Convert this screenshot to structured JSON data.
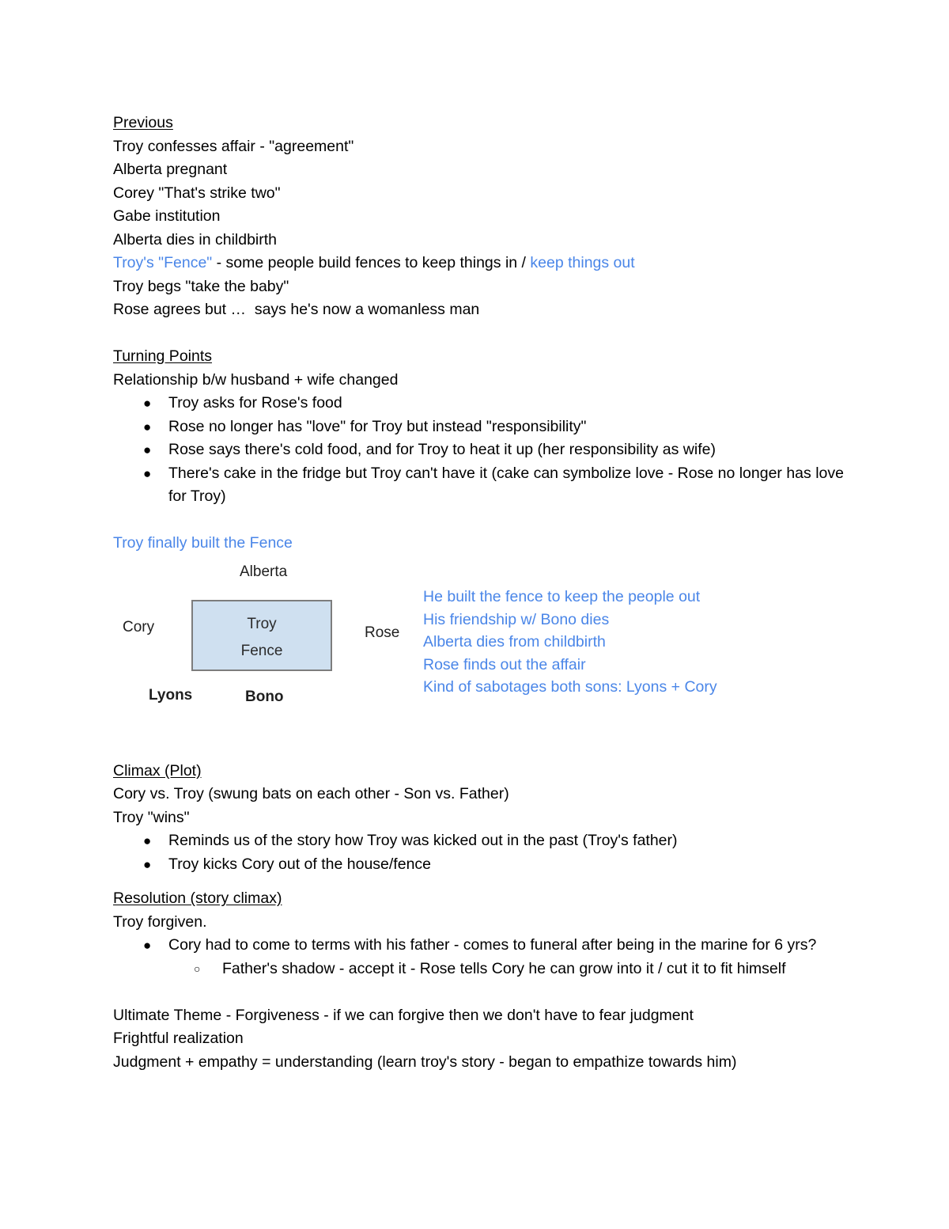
{
  "document": {
    "sections": {
      "previous": {
        "heading": "Previous",
        "lines": [
          "Troy confesses affair - \"agreement\"",
          "Alberta pregnant",
          "Corey \"That's strike two\"",
          "Gabe institution",
          "Alberta dies in childbirth"
        ],
        "fence_line": {
          "blue_start": "Troy's \"Fence\"",
          "black_middle": " - some people build fences to keep things in / ",
          "blue_end": "keep things out"
        },
        "lines_after": [
          "Troy begs \"take the baby\"",
          "Rose agrees but …  says he's now a womanless man"
        ]
      },
      "turning_points": {
        "heading": "Turning Points",
        "intro": "Relationship b/w husband + wife changed",
        "bullets": [
          "Troy asks for Rose's food",
          "Rose no longer has \"love\" for Troy but instead \"responsibility\"",
          "Rose says there's cold food, and for Troy to heat it up (her responsibility as wife)",
          "There's cake in the fridge but Troy can't have it (cake can symbolize love - Rose no longer has love for Troy)"
        ],
        "fence_built_line": "Troy finally built the Fence"
      },
      "climax": {
        "heading": "Climax (Plot)",
        "lines": [
          "Cory vs. Troy (swung bats on each other - Son vs. Father)",
          "Troy \"wins\""
        ],
        "bullets": [
          "Reminds us of the story how Troy was kicked out in the past (Troy's father)",
          "Troy kicks Cory out of the house/fence"
        ]
      },
      "resolution": {
        "heading": "Resolution (story climax)",
        "lines": [
          "Troy forgiven."
        ],
        "bullets": [
          "Cory had to come to terms with his father - comes to funeral after being in the marine for 6 yrs?"
        ],
        "sub_bullets": [
          "Father's shadow - accept it - Rose tells Cory he can grow into it / cut it to fit himself"
        ]
      },
      "theme": {
        "lines": [
          "Ultimate Theme - Forgiveness - if we can forgive then we don't have to fear judgment",
          "Frightful realization",
          "Judgment + empathy = understanding (learn troy's story - began to empathize towards him)"
        ]
      }
    }
  },
  "diagram": {
    "box": {
      "title": "Troy",
      "subtitle": "Fence",
      "fill_color": "#cfe0f0",
      "border_color": "#7d7d7d"
    },
    "labels": {
      "top": "Alberta",
      "left": "Cory",
      "right": "Rose",
      "bottom_left": "Lyons",
      "bottom_center": "Bono"
    },
    "annotations": [
      "He built the fence to keep the people out",
      "His friendship w/ Bono dies",
      "Alberta dies from childbirth",
      "Rose finds out the affair",
      "Kind of sabotages both sons: Lyons + Cory"
    ],
    "annotation_color": "#4a86e8"
  },
  "bullet_glyphs": {
    "filled": "●",
    "hollow": "○"
  }
}
